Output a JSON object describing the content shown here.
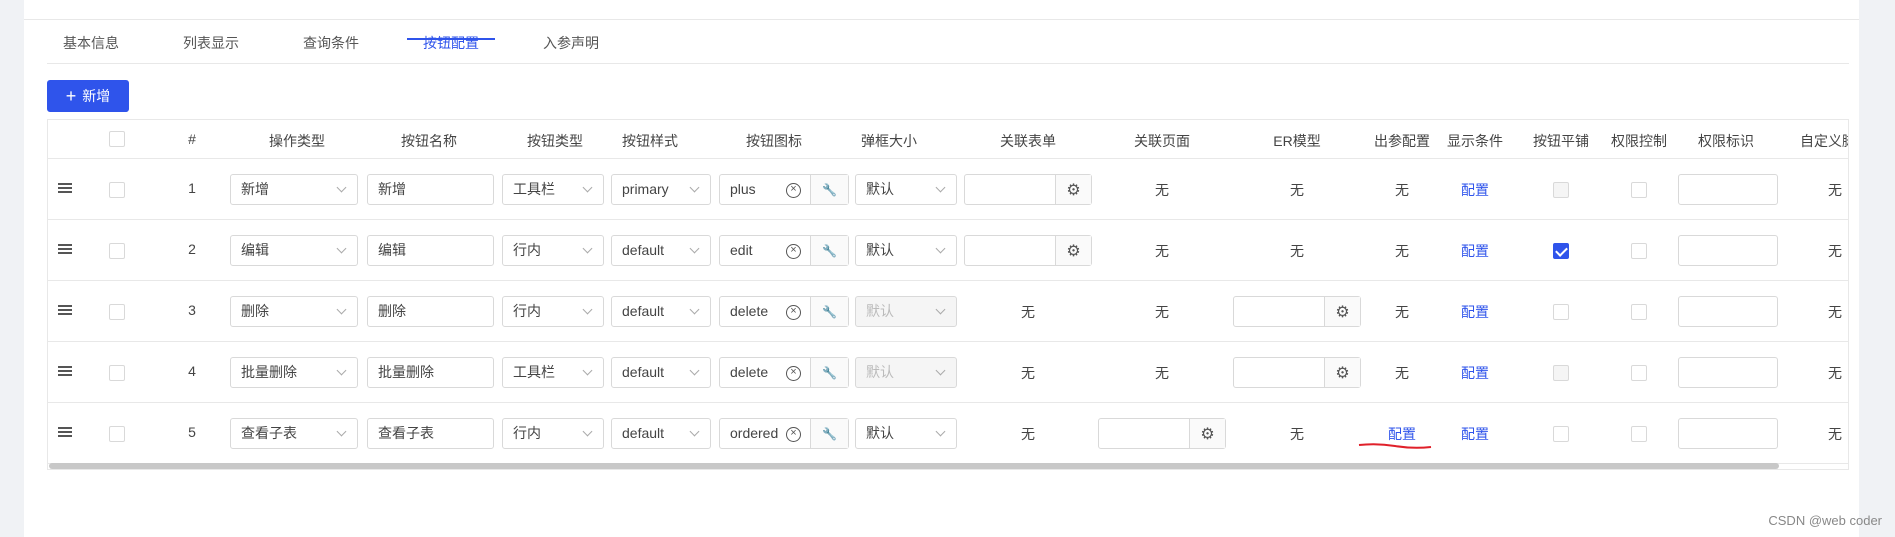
{
  "tabs": [
    {
      "label": "基本信息"
    },
    {
      "label": "列表显示"
    },
    {
      "label": "查询条件"
    },
    {
      "label": "按钮配置",
      "active": true
    },
    {
      "label": "入参声明"
    }
  ],
  "add_button": {
    "label": "新增",
    "icon": "plus-icon"
  },
  "columns": [
    "#",
    "操作类型",
    "按钮名称",
    "按钮类型",
    "按钮样式",
    "按钮图标",
    "弹框大小",
    "关联表单",
    "关联页面",
    "ER模型",
    "出参配置",
    "显示条件",
    "按钮平铺",
    "权限控制",
    "权限标识",
    "自定义脚本"
  ],
  "rows": [
    {
      "no": "1",
      "op_type": "新增",
      "name": "新增",
      "btn_type": "工具栏",
      "style": "primary",
      "icon": "plus",
      "size": "默认",
      "size_disabled": false,
      "form": {
        "kind": "field",
        "value": ""
      },
      "page": "无",
      "er": {
        "kind": "text",
        "value": "无"
      },
      "out": "无",
      "cond": "配置",
      "tile": "disabled",
      "perm": "off",
      "perm_id": "",
      "script": "无"
    },
    {
      "no": "2",
      "op_type": "编辑",
      "name": "编辑",
      "btn_type": "行内",
      "style": "default",
      "icon": "edit",
      "size": "默认",
      "size_disabled": false,
      "form": {
        "kind": "field",
        "value": ""
      },
      "page": "无",
      "er": {
        "kind": "text",
        "value": "无"
      },
      "out": "无",
      "cond": "配置",
      "tile": "on",
      "perm": "off",
      "perm_id": "",
      "script": "无"
    },
    {
      "no": "3",
      "op_type": "删除",
      "name": "删除",
      "btn_type": "行内",
      "style": "default",
      "icon": "delete",
      "size": "默认",
      "size_disabled": true,
      "form": {
        "kind": "text",
        "value": "无"
      },
      "page": "无",
      "er": {
        "kind": "field",
        "value": ""
      },
      "out": "无",
      "cond": "配置",
      "tile": "off",
      "perm": "off",
      "perm_id": "",
      "script": "无"
    },
    {
      "no": "4",
      "op_type": "批量删除",
      "name": "批量删除",
      "btn_type": "工具栏",
      "style": "default",
      "icon": "delete",
      "size": "默认",
      "size_disabled": true,
      "form": {
        "kind": "text",
        "value": "无"
      },
      "page": "无",
      "er": {
        "kind": "field",
        "value": ""
      },
      "out": "无",
      "cond": "配置",
      "tile": "disabled",
      "perm": "off",
      "perm_id": "",
      "script": "无"
    },
    {
      "no": "5",
      "op_type": "查看子表",
      "name": "查看子表",
      "btn_type": "行内",
      "style": "default",
      "icon": "ordered",
      "size": "默认",
      "size_disabled": false,
      "form": {
        "kind": "text",
        "value": "无"
      },
      "page": "field",
      "er": {
        "kind": "text",
        "value": "无"
      },
      "out": "配置",
      "out_link": true,
      "cond": "配置",
      "tile": "off",
      "perm": "off",
      "perm_id": "",
      "script": "无"
    }
  ],
  "watermark": "CSDN @web coder",
  "colors": {
    "primary": "#2f54eb",
    "annotation": "#e0202a"
  }
}
